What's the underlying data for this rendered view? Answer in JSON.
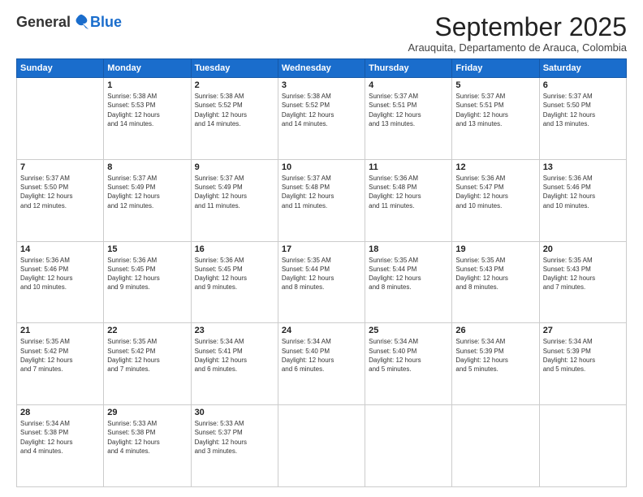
{
  "logo": {
    "general": "General",
    "blue": "Blue"
  },
  "title": "September 2025",
  "location": "Arauquita, Departamento de Arauca, Colombia",
  "days_of_week": [
    "Sunday",
    "Monday",
    "Tuesday",
    "Wednesday",
    "Thursday",
    "Friday",
    "Saturday"
  ],
  "weeks": [
    [
      {
        "day": "",
        "info": ""
      },
      {
        "day": "1",
        "info": "Sunrise: 5:38 AM\nSunset: 5:53 PM\nDaylight: 12 hours\nand 14 minutes."
      },
      {
        "day": "2",
        "info": "Sunrise: 5:38 AM\nSunset: 5:52 PM\nDaylight: 12 hours\nand 14 minutes."
      },
      {
        "day": "3",
        "info": "Sunrise: 5:38 AM\nSunset: 5:52 PM\nDaylight: 12 hours\nand 14 minutes."
      },
      {
        "day": "4",
        "info": "Sunrise: 5:37 AM\nSunset: 5:51 PM\nDaylight: 12 hours\nand 13 minutes."
      },
      {
        "day": "5",
        "info": "Sunrise: 5:37 AM\nSunset: 5:51 PM\nDaylight: 12 hours\nand 13 minutes."
      },
      {
        "day": "6",
        "info": "Sunrise: 5:37 AM\nSunset: 5:50 PM\nDaylight: 12 hours\nand 13 minutes."
      }
    ],
    [
      {
        "day": "7",
        "info": "Sunrise: 5:37 AM\nSunset: 5:50 PM\nDaylight: 12 hours\nand 12 minutes."
      },
      {
        "day": "8",
        "info": "Sunrise: 5:37 AM\nSunset: 5:49 PM\nDaylight: 12 hours\nand 12 minutes."
      },
      {
        "day": "9",
        "info": "Sunrise: 5:37 AM\nSunset: 5:49 PM\nDaylight: 12 hours\nand 11 minutes."
      },
      {
        "day": "10",
        "info": "Sunrise: 5:37 AM\nSunset: 5:48 PM\nDaylight: 12 hours\nand 11 minutes."
      },
      {
        "day": "11",
        "info": "Sunrise: 5:36 AM\nSunset: 5:48 PM\nDaylight: 12 hours\nand 11 minutes."
      },
      {
        "day": "12",
        "info": "Sunrise: 5:36 AM\nSunset: 5:47 PM\nDaylight: 12 hours\nand 10 minutes."
      },
      {
        "day": "13",
        "info": "Sunrise: 5:36 AM\nSunset: 5:46 PM\nDaylight: 12 hours\nand 10 minutes."
      }
    ],
    [
      {
        "day": "14",
        "info": "Sunrise: 5:36 AM\nSunset: 5:46 PM\nDaylight: 12 hours\nand 10 minutes."
      },
      {
        "day": "15",
        "info": "Sunrise: 5:36 AM\nSunset: 5:45 PM\nDaylight: 12 hours\nand 9 minutes."
      },
      {
        "day": "16",
        "info": "Sunrise: 5:36 AM\nSunset: 5:45 PM\nDaylight: 12 hours\nand 9 minutes."
      },
      {
        "day": "17",
        "info": "Sunrise: 5:35 AM\nSunset: 5:44 PM\nDaylight: 12 hours\nand 8 minutes."
      },
      {
        "day": "18",
        "info": "Sunrise: 5:35 AM\nSunset: 5:44 PM\nDaylight: 12 hours\nand 8 minutes."
      },
      {
        "day": "19",
        "info": "Sunrise: 5:35 AM\nSunset: 5:43 PM\nDaylight: 12 hours\nand 8 minutes."
      },
      {
        "day": "20",
        "info": "Sunrise: 5:35 AM\nSunset: 5:43 PM\nDaylight: 12 hours\nand 7 minutes."
      }
    ],
    [
      {
        "day": "21",
        "info": "Sunrise: 5:35 AM\nSunset: 5:42 PM\nDaylight: 12 hours\nand 7 minutes."
      },
      {
        "day": "22",
        "info": "Sunrise: 5:35 AM\nSunset: 5:42 PM\nDaylight: 12 hours\nand 7 minutes."
      },
      {
        "day": "23",
        "info": "Sunrise: 5:34 AM\nSunset: 5:41 PM\nDaylight: 12 hours\nand 6 minutes."
      },
      {
        "day": "24",
        "info": "Sunrise: 5:34 AM\nSunset: 5:40 PM\nDaylight: 12 hours\nand 6 minutes."
      },
      {
        "day": "25",
        "info": "Sunrise: 5:34 AM\nSunset: 5:40 PM\nDaylight: 12 hours\nand 5 minutes."
      },
      {
        "day": "26",
        "info": "Sunrise: 5:34 AM\nSunset: 5:39 PM\nDaylight: 12 hours\nand 5 minutes."
      },
      {
        "day": "27",
        "info": "Sunrise: 5:34 AM\nSunset: 5:39 PM\nDaylight: 12 hours\nand 5 minutes."
      }
    ],
    [
      {
        "day": "28",
        "info": "Sunrise: 5:34 AM\nSunset: 5:38 PM\nDaylight: 12 hours\nand 4 minutes."
      },
      {
        "day": "29",
        "info": "Sunrise: 5:33 AM\nSunset: 5:38 PM\nDaylight: 12 hours\nand 4 minutes."
      },
      {
        "day": "30",
        "info": "Sunrise: 5:33 AM\nSunset: 5:37 PM\nDaylight: 12 hours\nand 3 minutes."
      },
      {
        "day": "",
        "info": ""
      },
      {
        "day": "",
        "info": ""
      },
      {
        "day": "",
        "info": ""
      },
      {
        "day": "",
        "info": ""
      }
    ]
  ]
}
